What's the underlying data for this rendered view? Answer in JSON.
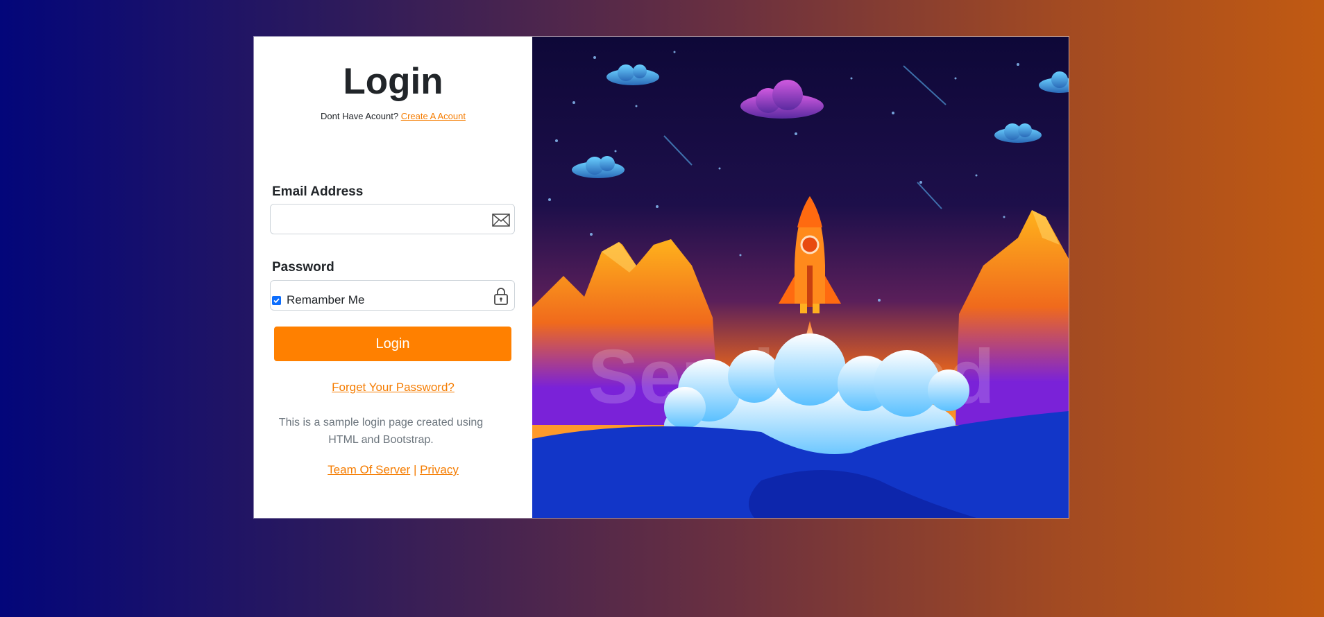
{
  "login_form": {
    "title": "Login",
    "no_account_text": "Dont Have Acount?",
    "create_account_link": "Create A Acount",
    "email_label": "Email Address",
    "email_value": "",
    "email_icon": "envelope-icon",
    "password_label": "Password",
    "password_value": "",
    "password_icon": "lock-icon",
    "remember_label": "Remamber Me",
    "remember_checked": true,
    "submit_label": "Login",
    "forgot_link": "Forget Your Password?",
    "description": "This is a sample login page created using HTML and Bootstrap.",
    "footer_link_1": "Team Of Server",
    "footer_separator": "|",
    "footer_link_2": "Privacy"
  },
  "illustration": {
    "watermark": "SendBrand"
  },
  "colors": {
    "accent": "#ff8000",
    "link": "#f57c00",
    "checkbox": "#0d6efd"
  }
}
